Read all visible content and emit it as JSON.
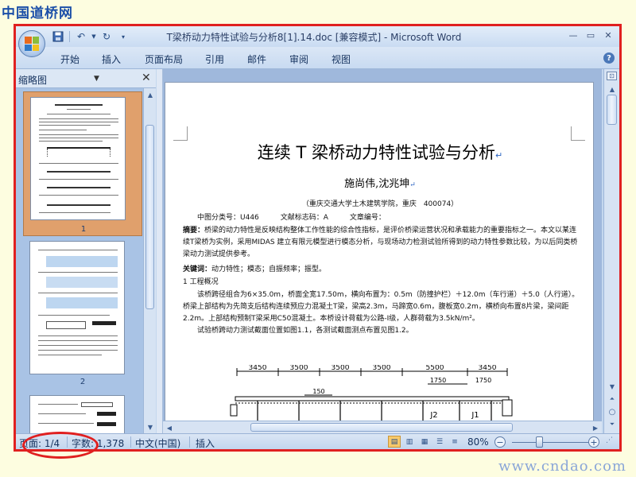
{
  "site": {
    "logo": "中国道桥网",
    "url": "www.cndao.com"
  },
  "window": {
    "title": "T梁桥动力特性试验与分析8[1].14.doc [兼容模式] - Microsoft Word"
  },
  "quick_access": [
    "save-icon",
    "undo-icon",
    "redo-icon",
    "customize-icon"
  ],
  "ribbon": {
    "tabs": [
      "开始",
      "插入",
      "页面布局",
      "引用",
      "邮件",
      "审阅",
      "视图"
    ]
  },
  "nav_pane": {
    "title": "缩略图",
    "thumbnails": [
      "1",
      "2"
    ]
  },
  "document": {
    "title": "连续 T 梁桥动力特性试验与分析",
    "authors": "施尚伟,沈兆坤",
    "affiliation": "（重庆交通大学土木建筑学院，重庆　400074）",
    "classification": "中图分类号：U446　　　文献标志码：A　　　文章编号：",
    "abstract_label": "摘要：",
    "abstract_text": "桥梁的动力特性是反映结构整体工作性能的综合性指标，是评价桥梁运营状况和承载能力的重要指标之一。本文以某连续T梁桥为实例，采用MIDAS 建立有限元模型进行模态分析，与现场动力检测试验所得到的动力特性参数比较，为以后同类桥梁动力测试提供参考。",
    "keywords_label": "关键词：",
    "keywords_text": "动力特性；模态；自振频率；振型。",
    "section1": "1 工程概况",
    "para1": "该桥跨径组合为6×35.0m，桥面全宽17.50m，横向布置为：0.5m（防撞护栏）＋12.0m（车行道）＋5.0（人行道）。桥梁上部结构为先简支后结构连续预应力混凝土T梁，梁高2.3m，马蹄宽0.6m，腹板宽0.2m，横桥向布置8片梁，梁间距2.2m。上部结构预制T梁采用C50混凝土。本桥设计荷载为公路-I级，人群荷载为3.5kN/m²。",
    "para2": "试验桥跨动力测试截面位置如图1.1，各测试截面测点布置见图1.2。",
    "figure": {
      "dims": [
        "3450",
        "3500",
        "3500",
        "3500",
        "5500",
        "3450"
      ],
      "sub_dims": [
        "1750",
        "1750"
      ],
      "tag": "150",
      "labels": [
        "J2",
        "J1"
      ]
    }
  },
  "status_bar": {
    "page": "页面: 1/4",
    "words": "字数: 1,378",
    "language": "中文(中国)",
    "mode": "插入",
    "zoom": "80%",
    "zoom_value": 0.8
  }
}
